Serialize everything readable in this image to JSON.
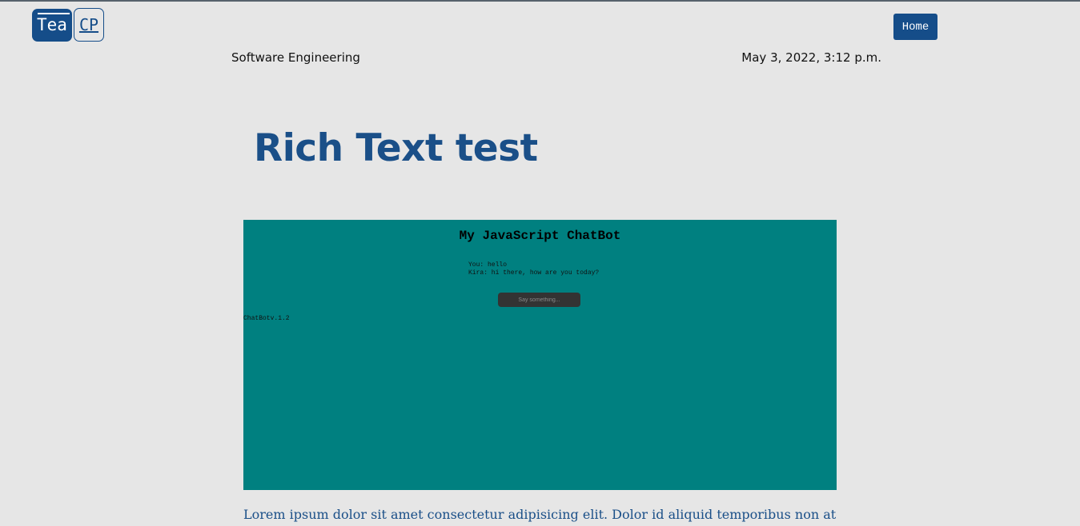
{
  "header": {
    "logo_left": "Tea",
    "logo_right": "CP",
    "home_label": "Home"
  },
  "post": {
    "category": "Software Engineering",
    "date": "May 3, 2022, 3:12 p.m.",
    "title": "Rich Text test",
    "body": "Lorem ipsum dolor sit amet consectetur adipisicing elit. Dolor id aliquid temporibus non atque"
  },
  "embed": {
    "title": "My JavaScript ChatBot",
    "messages": [
      "You: hello",
      "Kira: hi there, how are you today?"
    ],
    "input_placeholder": "Say something...",
    "version": "ChatBotv.1.2"
  },
  "colors": {
    "brand": "#154d89",
    "page_background": "#e6e6e6",
    "embed_background": "#008080"
  }
}
